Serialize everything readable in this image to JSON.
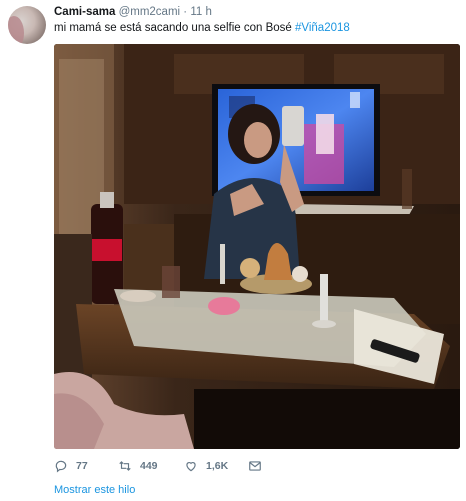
{
  "tweet": {
    "author_name": "Cami-sama",
    "author_handle": "@mm2cami",
    "separator": "·",
    "time": "11 h",
    "text_before": "mi mamá se está sacando una selfie con Bosé ",
    "hashtag": "#Viña2018",
    "media_label": "photo-living-room-tv-selfie"
  },
  "actions": {
    "reply_count": "77",
    "retweet_count": "449",
    "like_count": "1,6K"
  },
  "thread_link": "Mostrar este hilo",
  "colors": {
    "link": "#1b95e0",
    "muted": "#657786",
    "text": "#14171a"
  },
  "icons": [
    "reply-icon",
    "retweet-icon",
    "like-icon",
    "direct-message-icon"
  ]
}
